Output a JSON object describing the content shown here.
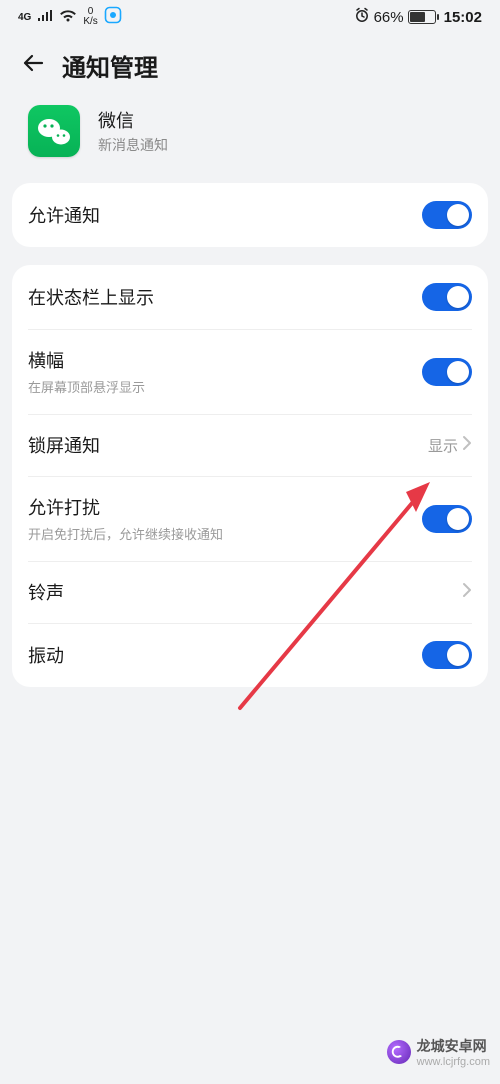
{
  "status_bar": {
    "network_label": "4G",
    "speed_top": "0",
    "speed_bottom": "K/s",
    "battery_percent_text": "66%",
    "battery_percent": 66,
    "time": "15:02"
  },
  "header": {
    "title": "通知管理"
  },
  "app": {
    "name": "微信",
    "subtitle": "新消息通知"
  },
  "group1": {
    "allow_notifications": {
      "title": "允许通知",
      "enabled": true
    }
  },
  "group2": {
    "status_bar_show": {
      "title": "在状态栏上显示",
      "enabled": true
    },
    "banner": {
      "title": "横幅",
      "subtitle": "在屏幕顶部悬浮显示",
      "enabled": true
    },
    "lockscreen": {
      "title": "锁屏通知",
      "value": "显示"
    },
    "allow_disturb": {
      "title": "允许打扰",
      "subtitle": "开启免打扰后，允许继续接收通知",
      "enabled": true
    },
    "ringtone": {
      "title": "铃声"
    },
    "vibrate": {
      "title": "振动",
      "enabled": true
    }
  },
  "watermark": {
    "text": "龙城安卓网",
    "url": "www.lcjrfg.com"
  }
}
